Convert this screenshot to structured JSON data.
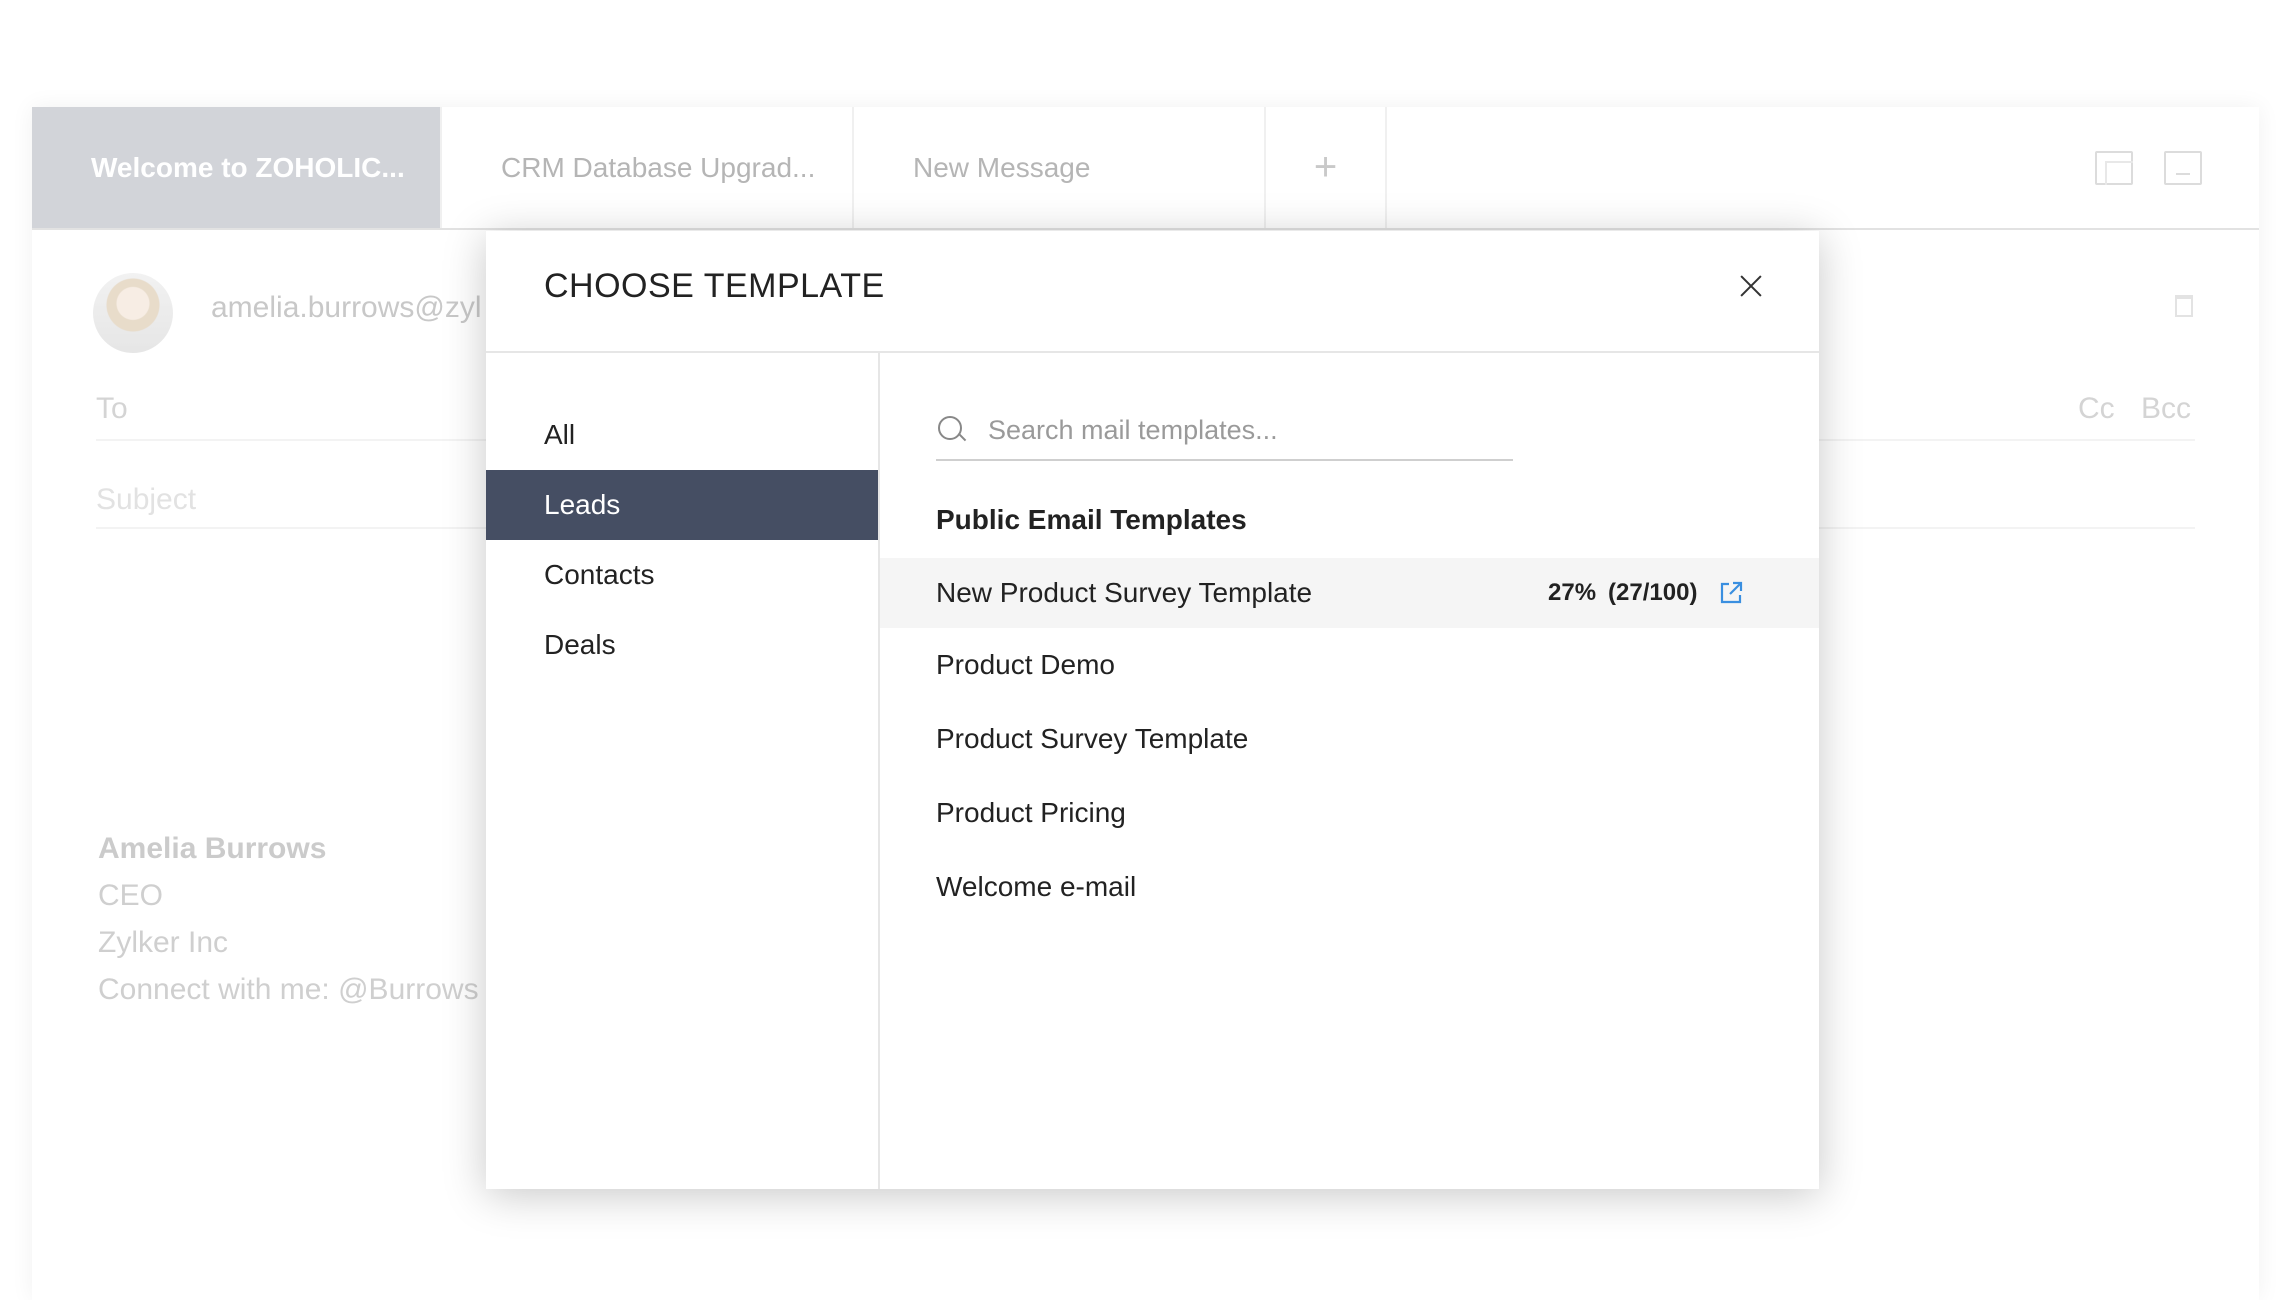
{
  "tabs": [
    {
      "label": "Welcome to ZOHOLIC...",
      "active": true
    },
    {
      "label": "CRM Database Upgrad...",
      "active": false
    },
    {
      "label": "New Message",
      "active": false
    }
  ],
  "tab_add_label": "+",
  "compose": {
    "from": "amelia.burrows@zyl",
    "to_label": "To",
    "cc_label": "Cc",
    "bcc_label": "Bcc",
    "subject_placeholder": "Subject",
    "signature": {
      "name": "Amelia Burrows",
      "title": "CEO",
      "company": "Zylker Inc",
      "social": "Connect with me: @Burrows"
    }
  },
  "modal": {
    "title": "CHOOSE TEMPLATE",
    "categories": [
      {
        "label": "All",
        "active": false
      },
      {
        "label": "Leads",
        "active": true
      },
      {
        "label": "Contacts",
        "active": false
      },
      {
        "label": "Deals",
        "active": false
      }
    ],
    "search": {
      "placeholder": "Search mail templates...",
      "value": ""
    },
    "section_title": "Public Email Templates",
    "templates": [
      {
        "name": "New Product Survey Template",
        "percent": "27%",
        "ratio": "(27/100)",
        "hover": true
      },
      {
        "name": "Product Demo"
      },
      {
        "name": "Product Survey Template"
      },
      {
        "name": "Product Pricing"
      },
      {
        "name": "Welcome e-mail"
      }
    ]
  },
  "colors": {
    "active_category_bg": "#454e63",
    "active_tab_bg": "#d2d4d9",
    "link_icon": "#3a8fe0",
    "hover_row_bg": "#f5f5f5"
  },
  "icons": {
    "close": "close-icon",
    "search": "search-icon",
    "external_link": "external-link-icon",
    "trash": "trash-icon",
    "restore": "restore-window-icon",
    "minimize": "minimize-window-icon"
  }
}
